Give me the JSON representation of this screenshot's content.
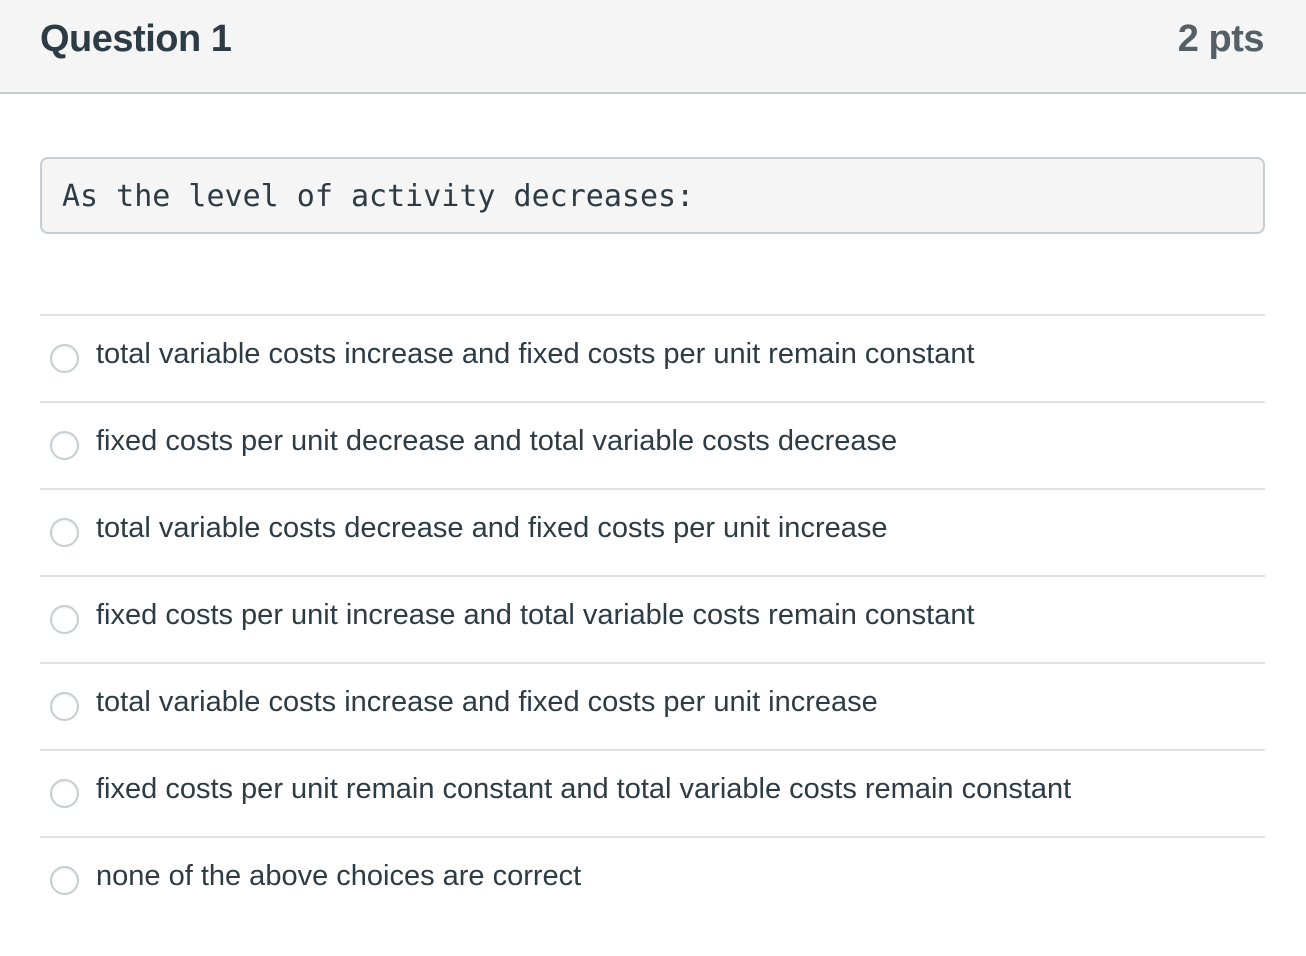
{
  "header": {
    "title": "Question 1",
    "points": "2 pts"
  },
  "question": {
    "text": "As the level of activity decreases:"
  },
  "answers": [
    {
      "label": "total variable costs increase and fixed costs per unit remain constant"
    },
    {
      "label": "fixed costs per unit decrease and total variable costs decrease"
    },
    {
      "label": "total variable costs decrease and fixed costs per unit increase"
    },
    {
      "label": "fixed costs per unit increase and total variable costs remain constant"
    },
    {
      "label": "total variable costs increase and fixed costs per unit increase"
    },
    {
      "label": "fixed costs per unit remain constant and total variable costs remain constant"
    },
    {
      "label": "none of the above choices are correct"
    }
  ]
}
